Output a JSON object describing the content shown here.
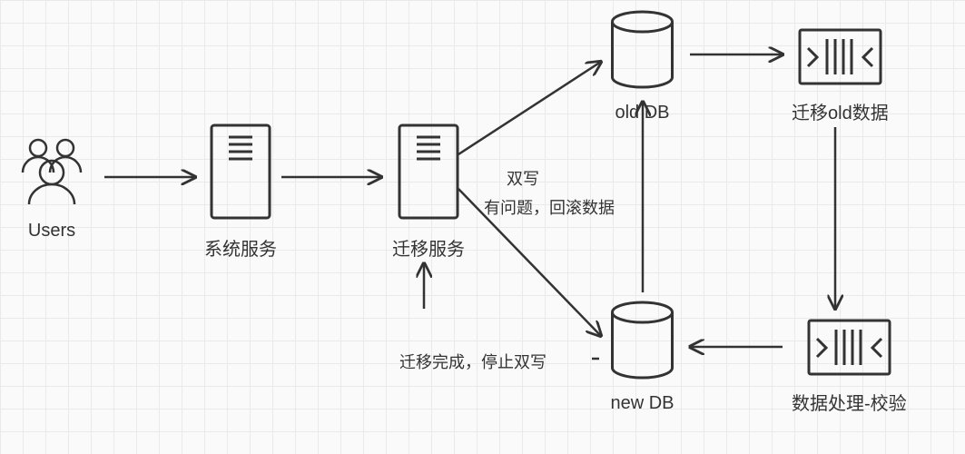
{
  "nodes": {
    "users": {
      "label": "Users"
    },
    "system_service": {
      "label": "系统服务"
    },
    "migration_service": {
      "label": "迁移服务"
    },
    "old_db": {
      "label": "old  DB"
    },
    "migrate_old_data": {
      "label": "迁移old数据"
    },
    "new_db": {
      "label": "new DB"
    },
    "data_process_verify": {
      "label": "数据处理-校验"
    }
  },
  "edges": {
    "dual_write": {
      "label": "双写"
    },
    "rollback": {
      "label": "有问题，回滚数据"
    },
    "migration_done": {
      "label": "迁移完成，停止双写"
    }
  }
}
